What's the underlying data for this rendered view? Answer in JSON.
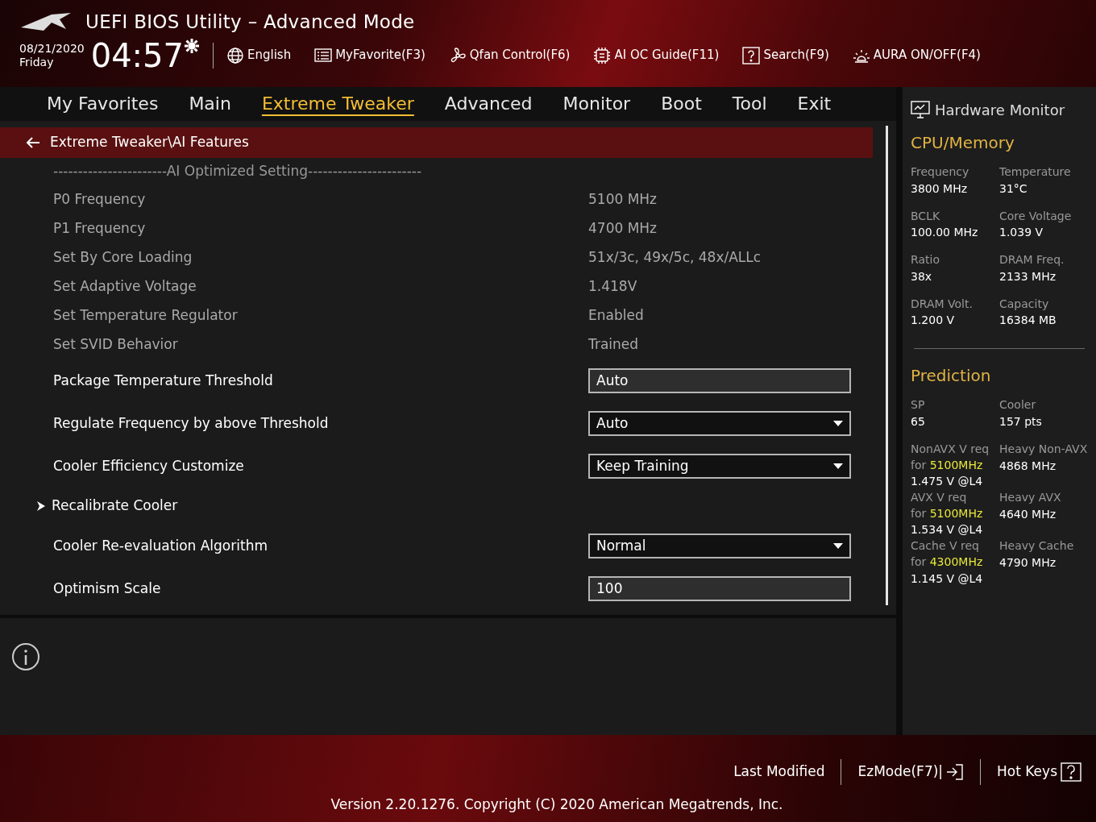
{
  "header": {
    "title": "UEFI BIOS Utility – Advanced Mode",
    "date": "08/21/2020",
    "day": "Friday",
    "time": "04:57",
    "tools": [
      {
        "kind": "globe",
        "label": "English"
      },
      {
        "kind": "list",
        "label": "MyFavorite(F3)"
      },
      {
        "kind": "fan",
        "label": "Qfan Control(F6)"
      },
      {
        "kind": "chip",
        "label": "AI OC Guide(F11)"
      },
      {
        "kind": "question",
        "label": "Search(F9)"
      },
      {
        "kind": "light",
        "label": "AURA ON/OFF(F4)"
      }
    ]
  },
  "tabs": [
    {
      "label": "My Favorites",
      "selected": false
    },
    {
      "label": "Main",
      "selected": false
    },
    {
      "label": "Extreme Tweaker",
      "selected": true
    },
    {
      "label": "Advanced",
      "selected": false
    },
    {
      "label": "Monitor",
      "selected": false
    },
    {
      "label": "Boot",
      "selected": false
    },
    {
      "label": "Tool",
      "selected": false
    },
    {
      "label": "Exit",
      "selected": false
    }
  ],
  "breadcrumb": "Extreme Tweaker\\AI Features",
  "settings": [
    {
      "kind": "separator",
      "label": "-----------------------AI Optimized Setting-----------------------"
    },
    {
      "kind": "info",
      "label": "P0 Frequency",
      "value": "5100 MHz"
    },
    {
      "kind": "info",
      "label": "P1 Frequency",
      "value": "4700 MHz"
    },
    {
      "kind": "info",
      "label": "Set By Core Loading",
      "value": "51x/3c, 49x/5c, 48x/ALLc"
    },
    {
      "kind": "info",
      "label": "Set Adaptive Voltage",
      "value": "1.418V"
    },
    {
      "kind": "info",
      "label": "Set Temperature Regulator",
      "value": "Enabled"
    },
    {
      "kind": "info",
      "label": "Set SVID Behavior",
      "value": "Trained"
    },
    {
      "kind": "text",
      "label": "Package Temperature Threshold",
      "value": "Auto"
    },
    {
      "kind": "select",
      "label": "Regulate Frequency by above Threshold",
      "value": "Auto"
    },
    {
      "kind": "select",
      "label": "Cooler Efficiency Customize",
      "value": "Keep Training"
    },
    {
      "kind": "submenu",
      "label": "Recalibrate Cooler"
    },
    {
      "kind": "select",
      "label": "Cooler Re-evaluation Algorithm",
      "value": "Normal"
    },
    {
      "kind": "text",
      "label": "Optimism Scale",
      "value": "100"
    }
  ],
  "monitor": {
    "title": "Hardware Monitor",
    "cpu_memory": {
      "title": "CPU/Memory",
      "items": [
        {
          "label": "Frequency",
          "value": "3800 MHz"
        },
        {
          "label": "Temperature",
          "value": "31°C"
        },
        {
          "label": "BCLK",
          "value": "100.00 MHz"
        },
        {
          "label": "Core Voltage",
          "value": "1.039 V"
        },
        {
          "label": "Ratio",
          "value": "38x"
        },
        {
          "label": "DRAM Freq.",
          "value": "2133 MHz"
        },
        {
          "label": "DRAM Volt.",
          "value": "1.200 V"
        },
        {
          "label": "Capacity",
          "value": "16384 MB"
        }
      ]
    },
    "prediction": {
      "title": "Prediction",
      "items": [
        {
          "label": "SP",
          "value": "65"
        },
        {
          "label": "Cooler",
          "value": "157 pts"
        }
      ],
      "rows": [
        {
          "left": {
            "label": "NonAVX V req",
            "prefix": "for",
            "highlight": "5100MHz",
            "value": "1.475 V @L4"
          },
          "right": {
            "label": "Heavy Non-AVX",
            "value": "4868 MHz"
          }
        },
        {
          "left": {
            "label": "AVX V req",
            "prefix": "for",
            "highlight": "5100MHz",
            "value": "1.534 V @L4"
          },
          "right": {
            "label": "Heavy AVX",
            "value": "4640 MHz"
          }
        },
        {
          "left": {
            "label": "Cache V req",
            "prefix": "for",
            "highlight": "4300MHz",
            "value": "1.145 V @L4"
          },
          "right": {
            "label": "Heavy Cache",
            "value": "4790 MHz"
          }
        }
      ]
    }
  },
  "footer": {
    "last_modified": "Last Modified",
    "ezmode": "EzMode(F7)|",
    "hotkeys": "Hot Keys",
    "version": "Version 2.20.1276. Copyright (C) 2020 American Megatrends, Inc."
  }
}
